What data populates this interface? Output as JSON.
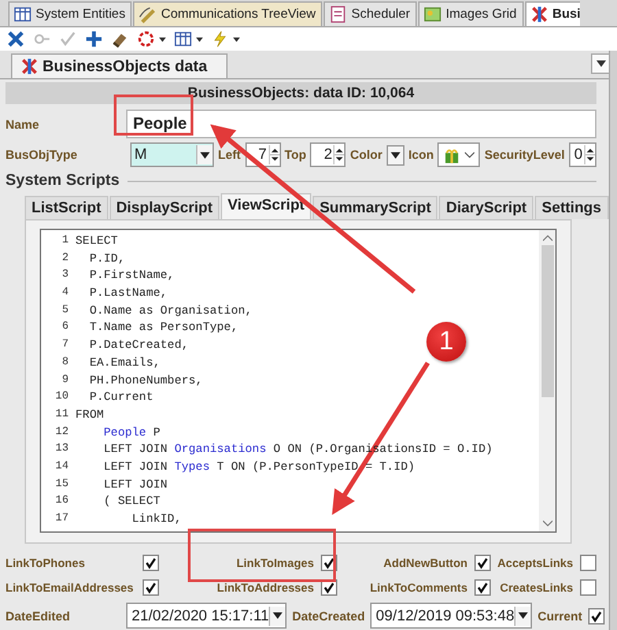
{
  "doc_tabs": [
    {
      "label": "System Entities",
      "selected": false
    },
    {
      "label": "Communications TreeView",
      "selected": false
    },
    {
      "label": "Scheduler",
      "selected": false
    },
    {
      "label": "Images Grid",
      "selected": false
    },
    {
      "label": "Busi",
      "selected": true
    }
  ],
  "toolbar": [
    {
      "disabled": false,
      "dropdown": false
    },
    {
      "disabled": true,
      "dropdown": false
    },
    {
      "disabled": true,
      "dropdown": false
    },
    {
      "disabled": false,
      "dropdown": false
    },
    {
      "disabled": false,
      "dropdown": false
    },
    {
      "disabled": false,
      "dropdown": true
    },
    {
      "disabled": false,
      "dropdown": true
    },
    {
      "disabled": false,
      "dropdown": true
    }
  ],
  "panel_tab": {
    "label": "BusinessObjects data"
  },
  "header": "BusinessObjects: data ID: 10,064",
  "name": {
    "label": "Name",
    "value": "People"
  },
  "type_row": {
    "busobjtype": {
      "label": "BusObjType",
      "value": "M"
    },
    "left": {
      "label": "Left",
      "value": "7"
    },
    "top": {
      "label": "Top",
      "value": "2"
    },
    "color": {
      "label": "Color"
    },
    "icon": {
      "label": "Icon"
    },
    "security": {
      "label": "SecurityLevel",
      "value": "0"
    }
  },
  "section_title": "System Scripts",
  "script_tabs": [
    {
      "label": "ListScript",
      "selected": false
    },
    {
      "label": "DisplayScript",
      "selected": false
    },
    {
      "label": "ViewScript",
      "selected": true
    },
    {
      "label": "SummaryScript",
      "selected": false
    },
    {
      "label": "DiaryScript",
      "selected": false
    },
    {
      "label": "Settings",
      "selected": false
    }
  ],
  "code_lines": [
    {
      "number": "1",
      "tokens": [
        {
          "text": "SELECT",
          "kind": "plain"
        }
      ]
    },
    {
      "number": "2",
      "tokens": [
        {
          "text": "  P.ID,",
          "kind": "plain"
        }
      ]
    },
    {
      "number": "3",
      "tokens": [
        {
          "text": "  P.FirstName,",
          "kind": "plain"
        }
      ]
    },
    {
      "number": "4",
      "tokens": [
        {
          "text": "  P.LastName,",
          "kind": "plain"
        }
      ]
    },
    {
      "number": "5",
      "tokens": [
        {
          "text": "  O.Name as Organisation,",
          "kind": "plain"
        }
      ]
    },
    {
      "number": "6",
      "tokens": [
        {
          "text": "  T.Name as PersonType,",
          "kind": "plain"
        }
      ]
    },
    {
      "number": "7",
      "tokens": [
        {
          "text": "  P.DateCreated,",
          "kind": "plain"
        }
      ]
    },
    {
      "number": "8",
      "tokens": [
        {
          "text": "  EA.Emails,",
          "kind": "plain"
        }
      ]
    },
    {
      "number": "9",
      "tokens": [
        {
          "text": "  PH.PhoneNumbers,",
          "kind": "plain"
        }
      ]
    },
    {
      "number": "10",
      "tokens": [
        {
          "text": "  P.Current",
          "kind": "plain"
        }
      ]
    },
    {
      "number": "11",
      "tokens": [
        {
          "text": "FROM",
          "kind": "plain"
        }
      ]
    },
    {
      "number": "12",
      "tokens": [
        {
          "text": "    People",
          "kind": "table"
        },
        {
          "text": " P",
          "kind": "plain"
        }
      ]
    },
    {
      "number": "13",
      "tokens": [
        {
          "text": "    LEFT JOIN ",
          "kind": "plain"
        },
        {
          "text": "Organisations",
          "kind": "table"
        },
        {
          "text": " O ON (P.OrganisationsID = O.ID)",
          "kind": "plain"
        }
      ]
    },
    {
      "number": "14",
      "tokens": [
        {
          "text": "    LEFT JOIN ",
          "kind": "plain"
        },
        {
          "text": "Types",
          "kind": "table"
        },
        {
          "text": " T ON (P.PersonTypeID = T.ID)",
          "kind": "plain"
        }
      ]
    },
    {
      "number": "15",
      "tokens": [
        {
          "text": "    LEFT JOIN",
          "kind": "plain"
        }
      ]
    },
    {
      "number": "16",
      "tokens": [
        {
          "text": "    ( SELECT",
          "kind": "plain"
        }
      ]
    },
    {
      "number": "17",
      "tokens": [
        {
          "text": "        LinkID,",
          "kind": "plain"
        }
      ]
    }
  ],
  "checks": [
    {
      "label": "LinkToPhones",
      "checked": true
    },
    {
      "label": "LinkToImages",
      "checked": true
    },
    {
      "label": "AddNewButton",
      "checked": true
    },
    {
      "label": "AcceptsLinks",
      "checked": false
    },
    {
      "label": "LinkToEmailAddresses",
      "checked": true
    },
    {
      "label": "LinkToAddresses",
      "checked": true
    },
    {
      "label": "LinkToComments",
      "checked": true
    },
    {
      "label": "CreatesLinks",
      "checked": false
    }
  ],
  "dates": {
    "edited": {
      "label": "DateEdited",
      "value": "21/02/2020 15:17:11"
    },
    "created": {
      "label": "DateCreated",
      "value": "09/12/2019 09:53:48"
    },
    "current": {
      "label": "Current",
      "checked": true
    }
  },
  "annotation": {
    "badge": "1"
  }
}
